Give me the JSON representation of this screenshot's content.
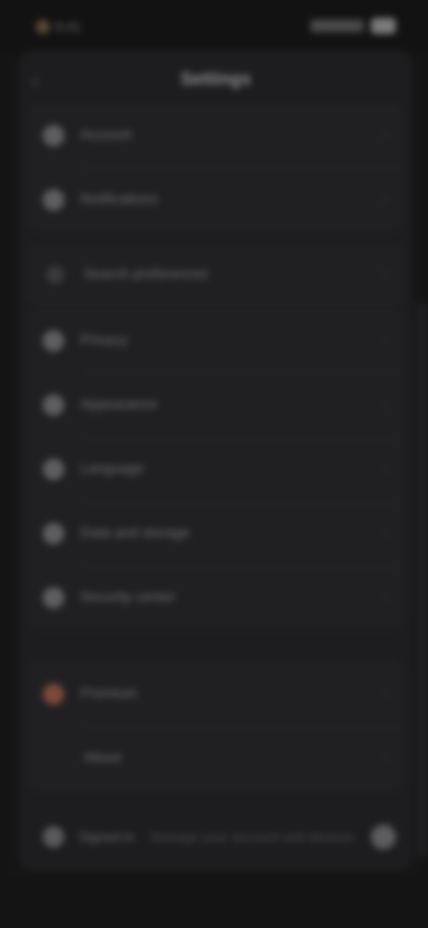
{
  "status_bar": {
    "time": "9:41"
  },
  "header": {
    "title": "Settings",
    "back_icon": "chevron-left-icon"
  },
  "group1": [
    {
      "icon": "user-icon",
      "label": "Account"
    },
    {
      "icon": "bell-icon",
      "label": "Notifications"
    }
  ],
  "group2": [
    {
      "icon": "search-icon",
      "label": "Search preferences"
    }
  ],
  "group3": [
    {
      "icon": "lock-icon",
      "label": "Privacy"
    },
    {
      "icon": "palette-icon",
      "label": "Appearance"
    },
    {
      "icon": "globe-icon",
      "label": "Language"
    },
    {
      "icon": "storage-icon",
      "label": "Data and storage"
    },
    {
      "icon": "shield-icon",
      "label": "Security center"
    }
  ],
  "group4": [
    {
      "icon": "star-icon",
      "label": "Premium"
    },
    {
      "icon": "info-icon",
      "label": "About"
    }
  ],
  "footer": {
    "label": "Signed in",
    "sub": "Manage your account and devices",
    "action_icon": "more-icon"
  },
  "colors": {
    "background": "#151515",
    "panel": "#1d1d1f",
    "accent": "#7a4a3a"
  }
}
